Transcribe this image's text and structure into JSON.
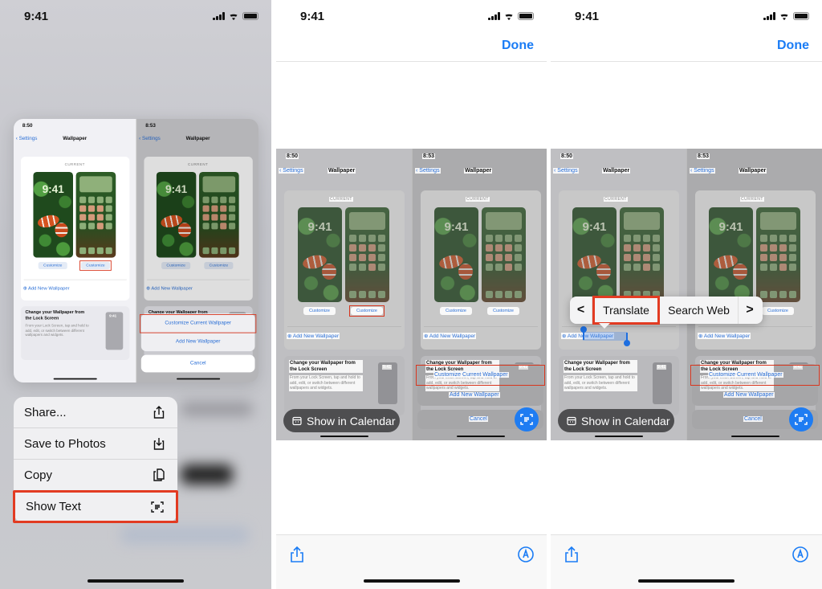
{
  "status": {
    "time": "9:41"
  },
  "nav": {
    "done_label": "Done"
  },
  "mini": {
    "time_left": "8:50",
    "time_right": "8:53",
    "back_label": "Settings",
    "title": "Wallpaper",
    "current_label": "CURRENT",
    "lock_time": "9:41",
    "customize_label": "Customize",
    "add_new_label": "Add New Wallpaper",
    "tip_title": "Change your Wallpaper from the Lock Screen",
    "tip_body": "From your Lock Screen, tap and hold to add, edit, or switch between different wallpapers and widgets.",
    "tip_thumb_time": "9:41",
    "sheet": {
      "customize_current": "Customize Current Wallpaper",
      "add_new": "Add New Wallpaper",
      "cancel": "Cancel"
    }
  },
  "context_menu": {
    "items": [
      {
        "label": "Share...",
        "icon": "share-icon"
      },
      {
        "label": "Save to Photos",
        "icon": "save-to-photos-icon"
      },
      {
        "label": "Copy",
        "icon": "copy-icon"
      },
      {
        "label": "Show Text",
        "icon": "live-text-icon"
      }
    ]
  },
  "live_text": {
    "data_detector_label": "Show in Calendar"
  },
  "text_popup": {
    "prev": "<",
    "translate": "Translate",
    "search_web": "Search Web",
    "next": ">"
  },
  "colors": {
    "accent": "#1a7cf5",
    "highlight": "#e23b22",
    "live_text_button": "#1e7cf2"
  }
}
